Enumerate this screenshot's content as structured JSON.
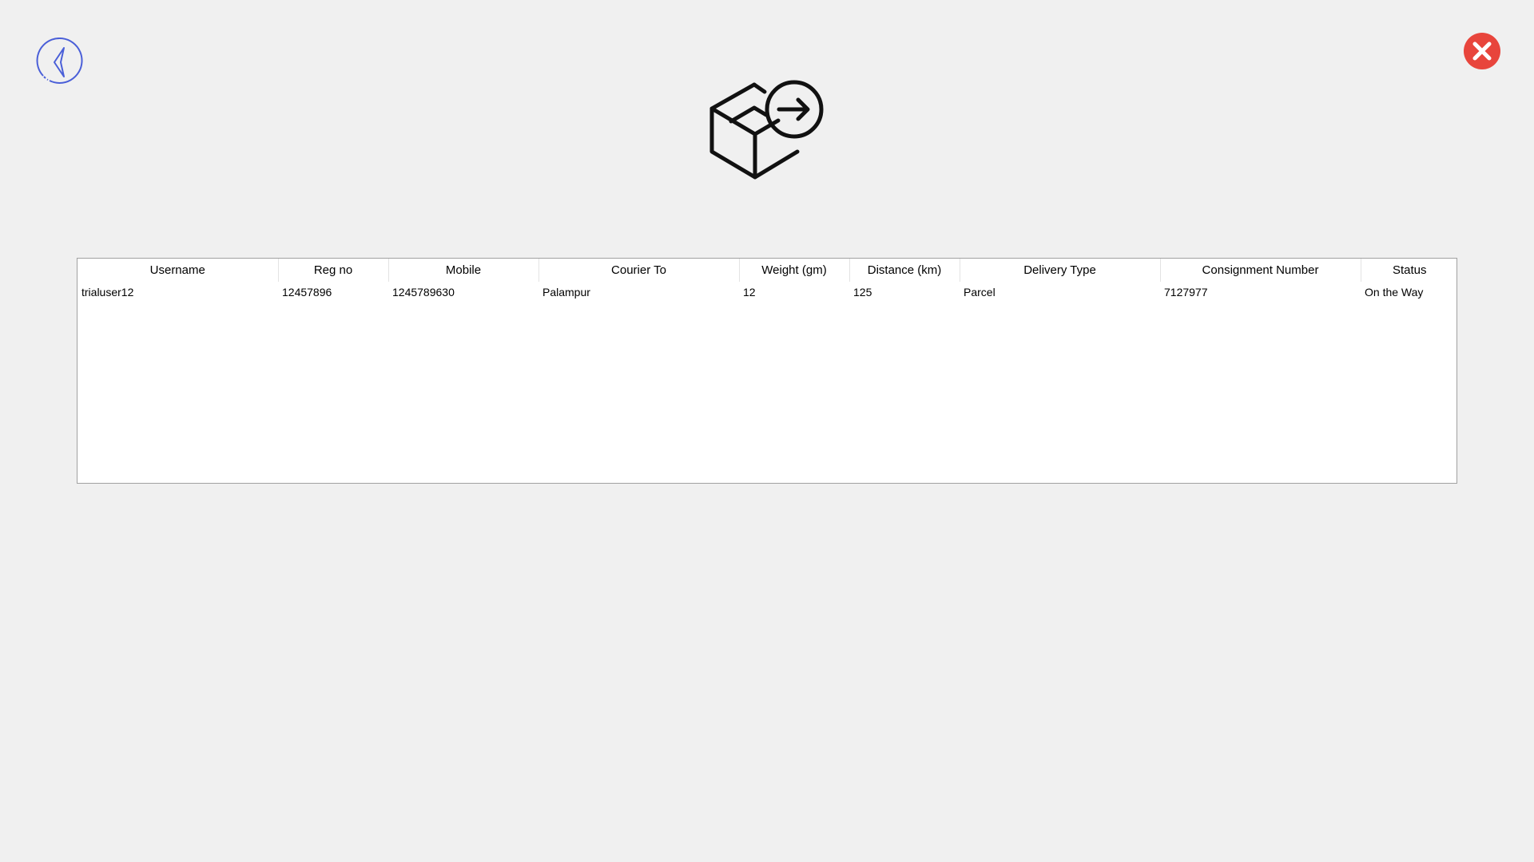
{
  "window": {
    "back_icon": "chevron-left-circle-icon",
    "close_icon": "close-circle-icon",
    "close_color": "#e8453c",
    "back_color": "#4a5fd8",
    "logo_icon": "package-send-icon"
  },
  "table": {
    "headers": [
      "Username",
      "Reg no",
      "Mobile",
      "Courier To",
      "Weight (gm)",
      "Distance (km)",
      "Delivery Type",
      "Consignment Number",
      "Status"
    ],
    "rows": [
      {
        "username": "trialuser12",
        "reg_no": "12457896",
        "mobile": "1245789630",
        "courier_to": "Palampur",
        "weight": "12",
        "distance": "125",
        "delivery_type": "Parcel",
        "consignment_number": "7127977",
        "status": "On the Way"
      }
    ]
  }
}
